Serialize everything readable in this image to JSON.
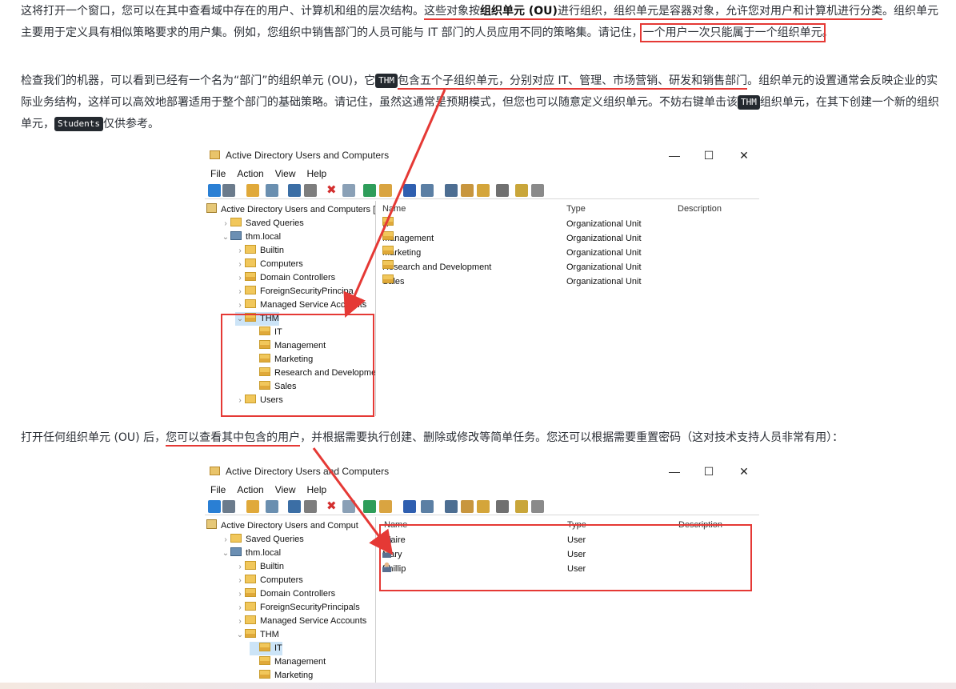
{
  "paragraphs": {
    "p1": {
      "a": "这将打开一个窗口，您可以在其中查看域中存在的用户、计算机和组的层次结构。",
      "b": "这些对象按",
      "b_bold": "组织单元 (OU)",
      "c": "进行组织，组织单元是容器对象，",
      "d": "允许您对用户和计算机进行分类",
      "e": "。组织单元主要用于定义具有相似策略要求的用户集。例如，您组织中销售部门的人员可能与 IT 部门的人员应用不同的策略集。请记住，",
      "f": "一个用户一次只能属于一个组织单元",
      "g": "。"
    },
    "p2": {
      "a": "检查我们的机器，可以看到已经有一个名为“部门”的组织单元 (OU)，它",
      "code1": "THM",
      "b": "包含五个子组织单元，分别对应 IT、管理、市场营销、研发和销售部门",
      "c": "。组织单元的设置通常会反映企业的实际业务结构，这样可以高效地部署适用于整个部门的基础策略。请记住，虽然这通常是预期模式，但您也可以随意定义组织单元。不妨右键单击该",
      "code2": "THM",
      "d": "组织单元，在其下创建一个新的组织单元，",
      "code3": "Students",
      "e": "仅供参考。"
    },
    "p3": {
      "a": "打开任何组织单元 (OU) 后，",
      "b": "您可以查看其中包含的用户",
      "c": "，并根据需要执行创建、删除或修改等简单任务。您还可以根据需要重置密码（这对技术支持人员非常有用）："
    }
  },
  "window1": {
    "title": "Active Directory Users and Computers",
    "controls": {
      "minimize": "—",
      "maximize": "☐",
      "close": "✕"
    },
    "menu": [
      "File",
      "Action",
      "View",
      "Help"
    ],
    "tree": [
      {
        "label": "Active Directory Users and Computers [",
        "level": 0,
        "chev": "",
        "icon": "book"
      },
      {
        "label": "Saved Queries",
        "level": 1,
        "chev": "›",
        "icon": "folder"
      },
      {
        "label": "thm.local",
        "level": 1,
        "chev": "⌄",
        "icon": "domain"
      },
      {
        "label": "Builtin",
        "level": 2,
        "chev": "›",
        "icon": "folder"
      },
      {
        "label": "Computers",
        "level": 2,
        "chev": "›",
        "icon": "folder"
      },
      {
        "label": "Domain Controllers",
        "level": 2,
        "chev": "›",
        "icon": "ou"
      },
      {
        "label": "ForeignSecurityPrincipa",
        "level": 2,
        "chev": "›",
        "icon": "folder"
      },
      {
        "label": "Managed Service Accounts",
        "level": 2,
        "chev": "›",
        "icon": "folder"
      },
      {
        "label": "THM",
        "level": 2,
        "chev": "⌄",
        "icon": "ou",
        "selected": true
      },
      {
        "label": "IT",
        "level": 3,
        "chev": "",
        "icon": "ou"
      },
      {
        "label": "Management",
        "level": 3,
        "chev": "",
        "icon": "ou"
      },
      {
        "label": "Marketing",
        "level": 3,
        "chev": "",
        "icon": "ou"
      },
      {
        "label": "Research and Development",
        "level": 3,
        "chev": "",
        "icon": "ou"
      },
      {
        "label": "Sales",
        "level": 3,
        "chev": "",
        "icon": "ou"
      },
      {
        "label": "Users",
        "level": 2,
        "chev": "›",
        "icon": "folder"
      }
    ],
    "columns": [
      "Name",
      "Type",
      "Description"
    ],
    "rows": [
      {
        "name": "IT",
        "type": "Organizational Unit",
        "description": ""
      },
      {
        "name": "Management",
        "type": "Organizational Unit",
        "description": ""
      },
      {
        "name": "Marketing",
        "type": "Organizational Unit",
        "description": ""
      },
      {
        "name": "Research and Development",
        "type": "Organizational Unit",
        "description": ""
      },
      {
        "name": "Sales",
        "type": "Organizational Unit",
        "description": ""
      }
    ]
  },
  "window2": {
    "title": "Active Directory Users and Computers",
    "controls": {
      "minimize": "—",
      "maximize": "☐",
      "close": "✕"
    },
    "menu": [
      "File",
      "Action",
      "View",
      "Help"
    ],
    "tree": [
      {
        "label": "Active Directory Users and Comput",
        "level": 0,
        "chev": "",
        "icon": "book"
      },
      {
        "label": "Saved Queries",
        "level": 1,
        "chev": "›",
        "icon": "folder"
      },
      {
        "label": "thm.local",
        "level": 1,
        "chev": "⌄",
        "icon": "domain"
      },
      {
        "label": "Builtin",
        "level": 2,
        "chev": "›",
        "icon": "folder"
      },
      {
        "label": "Computers",
        "level": 2,
        "chev": "›",
        "icon": "folder"
      },
      {
        "label": "Domain Controllers",
        "level": 2,
        "chev": "›",
        "icon": "ou"
      },
      {
        "label": "ForeignSecurityPrincipals",
        "level": 2,
        "chev": "›",
        "icon": "folder"
      },
      {
        "label": "Managed Service Accounts",
        "level": 2,
        "chev": "›",
        "icon": "folder"
      },
      {
        "label": "THM",
        "level": 2,
        "chev": "⌄",
        "icon": "ou"
      },
      {
        "label": "IT",
        "level": 3,
        "chev": "",
        "icon": "ou",
        "selected": true
      },
      {
        "label": "Management",
        "level": 3,
        "chev": "",
        "icon": "ou"
      },
      {
        "label": "Marketing",
        "level": 3,
        "chev": "",
        "icon": "ou"
      }
    ],
    "columns": [
      "Name",
      "Type",
      "Description"
    ],
    "rows": [
      {
        "name": "Claire",
        "type": "User",
        "description": ""
      },
      {
        "name": "Mary",
        "type": "User",
        "description": ""
      },
      {
        "name": "Phillip",
        "type": "User",
        "description": ""
      }
    ]
  },
  "colors": {
    "annotation_red": "#e53935",
    "code_bg": "#24292f",
    "selection": "#cce4f7",
    "folder": "#f1c75b"
  },
  "toolbar_icons": [
    "back-arrow-icon",
    "forward-arrow-icon",
    "up-folder-icon",
    "console-tree-icon",
    "cut-icon",
    "copy-icon",
    "delete-icon",
    "properties-icon",
    "refresh-icon",
    "export-icon",
    "help-icon",
    "view-icon",
    "new-user-icon",
    "new-group-icon",
    "new-ou-icon",
    "filter-icon",
    "find-icon",
    "add-to-group-icon"
  ]
}
